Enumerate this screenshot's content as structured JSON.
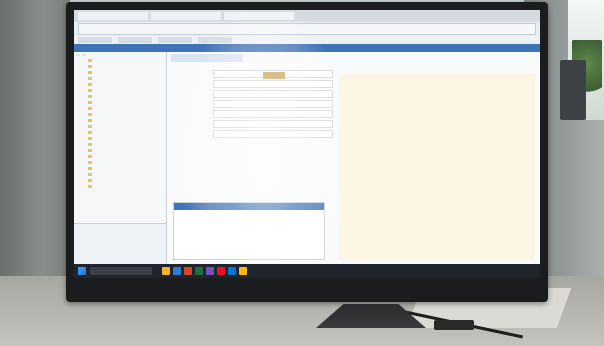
{
  "browser": {
    "tabs": [
      "",
      "",
      ""
    ],
    "address": ""
  },
  "app": {
    "header": "",
    "sidebar_tabs": [
      "",
      ""
    ],
    "tree_items": [
      "",
      "",
      "",
      "",
      "",
      "",
      "",
      "",
      "",
      "",
      "",
      "",
      "",
      "",
      "",
      "",
      "",
      "",
      "",
      "",
      "",
      ""
    ],
    "bottom_rows": [
      "",
      "",
      ""
    ],
    "main_tab": "",
    "button": "",
    "form_rows": [
      "",
      "",
      "",
      "",
      "",
      "",
      ""
    ],
    "details_header": "",
    "details_rows": [
      "",
      "",
      "",
      "",
      "",
      ""
    ],
    "right_tool": ""
  },
  "taskbar": {
    "search": "",
    "tray": [
      "",
      ""
    ]
  },
  "colors": {
    "app_header": "#3f73b8",
    "taskbar": "#20242c",
    "preview": "#fbf6e4"
  }
}
